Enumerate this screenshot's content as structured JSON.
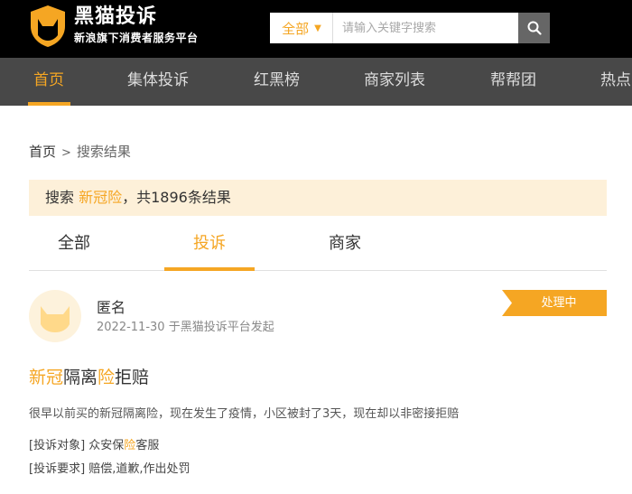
{
  "brand": {
    "title": "黑猫投诉",
    "slogan": "新浪旗下消费者服务平台"
  },
  "search": {
    "scope": "全部",
    "placeholder": "请输入关键字搜索",
    "icon": "search-icon"
  },
  "nav": {
    "items": [
      {
        "label": "首页",
        "active": true
      },
      {
        "label": "集体投诉"
      },
      {
        "label": "红黑榜"
      },
      {
        "label": "商家列表"
      },
      {
        "label": "帮帮团"
      },
      {
        "label": "热点"
      }
    ]
  },
  "breadcrumb": {
    "home": "首页",
    "separator": ">",
    "current": "搜索结果"
  },
  "result": {
    "prefix": "搜索 ",
    "keyword": "新冠险",
    "suffix": "，共1896条结果"
  },
  "tabs": [
    {
      "label": "全部"
    },
    {
      "label": "投诉",
      "active": true
    },
    {
      "label": "商家"
    }
  ],
  "complaint": {
    "user": "匿名",
    "date": "2022-11-30",
    "meta_suffix": " 于黑猫投诉平台发起",
    "status": "处理中",
    "title_parts": {
      "p1": "新冠",
      "p2": "隔离",
      "p3": "险",
      "p4": "拒赔"
    },
    "body": "很早以前买的新冠隔离险，现在发生了疫情，小区被封了3天，现在却以非密接拒赔",
    "target_label": "[投诉对象]",
    "target_parts": {
      "p1": " 众安保",
      "p2": "险",
      "p3": "客服"
    },
    "demand_label": "[投诉要求]",
    "demand": " 赔偿,道歉,作出处罚"
  },
  "colors": {
    "accent": "#f5a623",
    "topbar": "#000000",
    "navbar": "#484848",
    "highlight_bg": "#fdf0d9"
  }
}
